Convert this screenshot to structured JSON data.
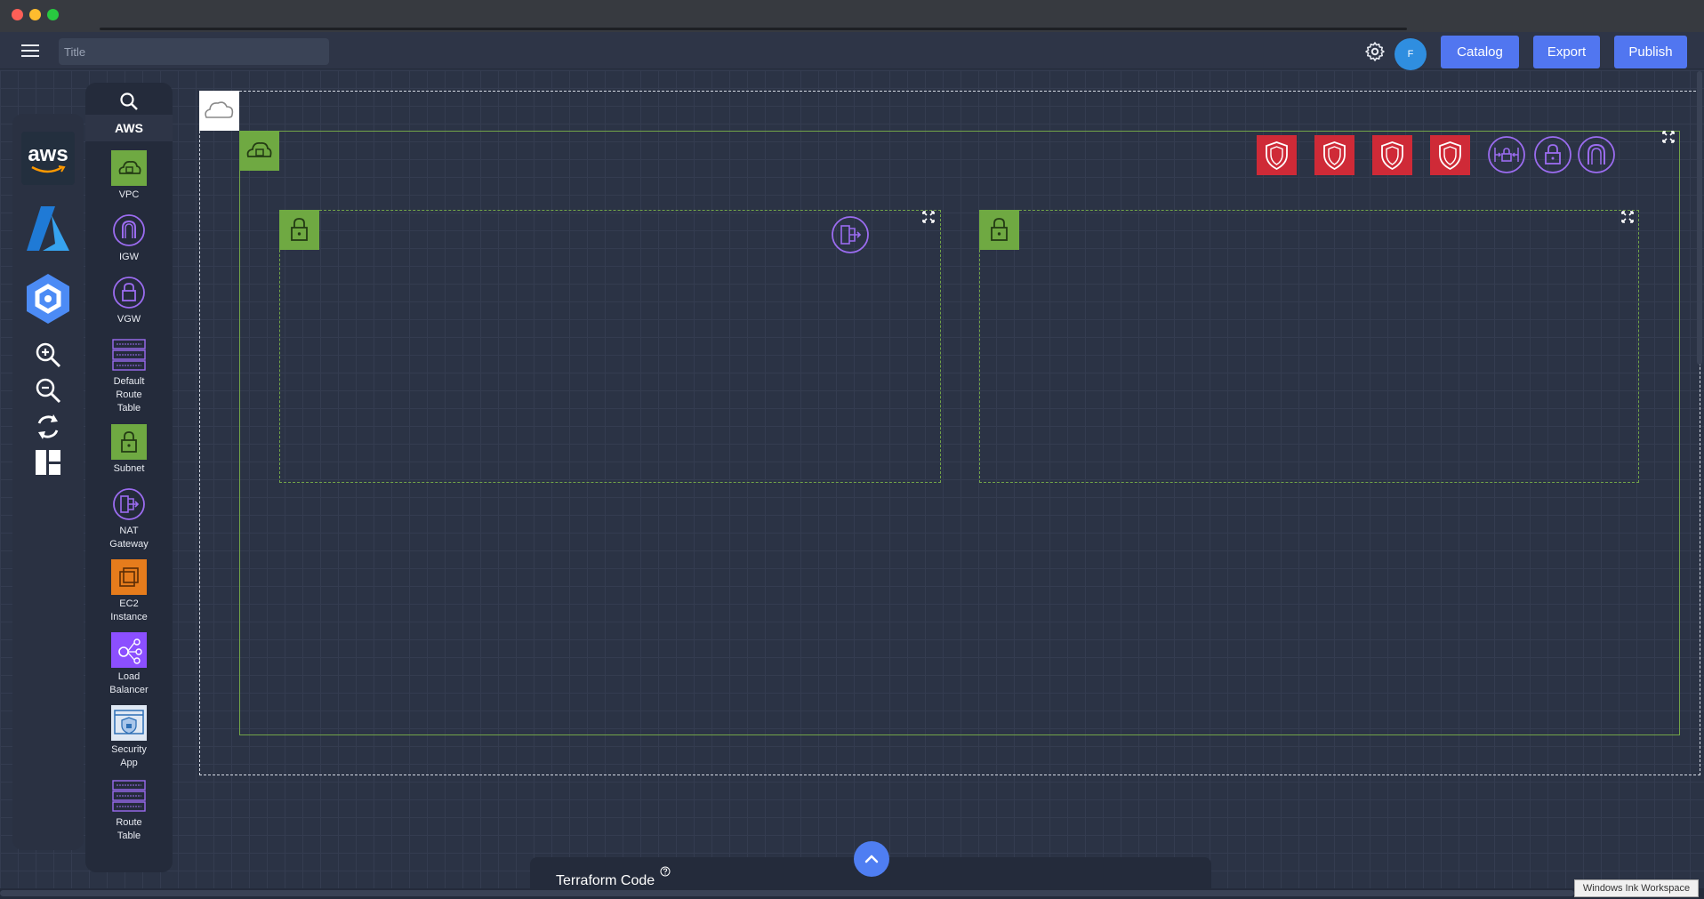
{
  "header": {
    "title_placeholder": "Title",
    "avatar_initial": "F",
    "catalog_label": "Catalog",
    "export_label": "Export",
    "publish_label": "Publish"
  },
  "toolbar": {
    "providers": [
      {
        "name": "aws",
        "label": "aws"
      },
      {
        "name": "azure",
        "label": ""
      },
      {
        "name": "gcp",
        "label": ""
      }
    ],
    "tools": [
      "zoom-in-icon",
      "zoom-out-icon",
      "refresh-icon",
      "layout-icon"
    ]
  },
  "palette": {
    "heading": "AWS",
    "items": [
      {
        "label": "VPC",
        "icon": "vpc-icon"
      },
      {
        "label": "IGW",
        "icon": "igw-icon"
      },
      {
        "label": "VGW",
        "icon": "vgw-icon"
      },
      {
        "label": "Default\nRoute\nTable",
        "icon": "route-table-icon"
      },
      {
        "label": "Subnet",
        "icon": "subnet-icon"
      },
      {
        "label": "NAT\nGateway",
        "icon": "nat-gateway-icon"
      },
      {
        "label": "EC2\nInstance",
        "icon": "ec2-icon"
      },
      {
        "label": "Load\nBalancer",
        "icon": "load-balancer-icon"
      },
      {
        "label": "Security\nApp",
        "icon": "security-app-icon"
      },
      {
        "label": "Route\nTable",
        "icon": "route-table-icon"
      }
    ]
  },
  "footer": {
    "terraform_label": "Terraform Code"
  },
  "system": {
    "ink_workspace": "Windows Ink Workspace"
  },
  "colors": {
    "accent": "#5176f0",
    "aws_green": "#6fa942",
    "security_red": "#cf2a37",
    "purple": "#8c4fff",
    "background": "#2b3345"
  }
}
